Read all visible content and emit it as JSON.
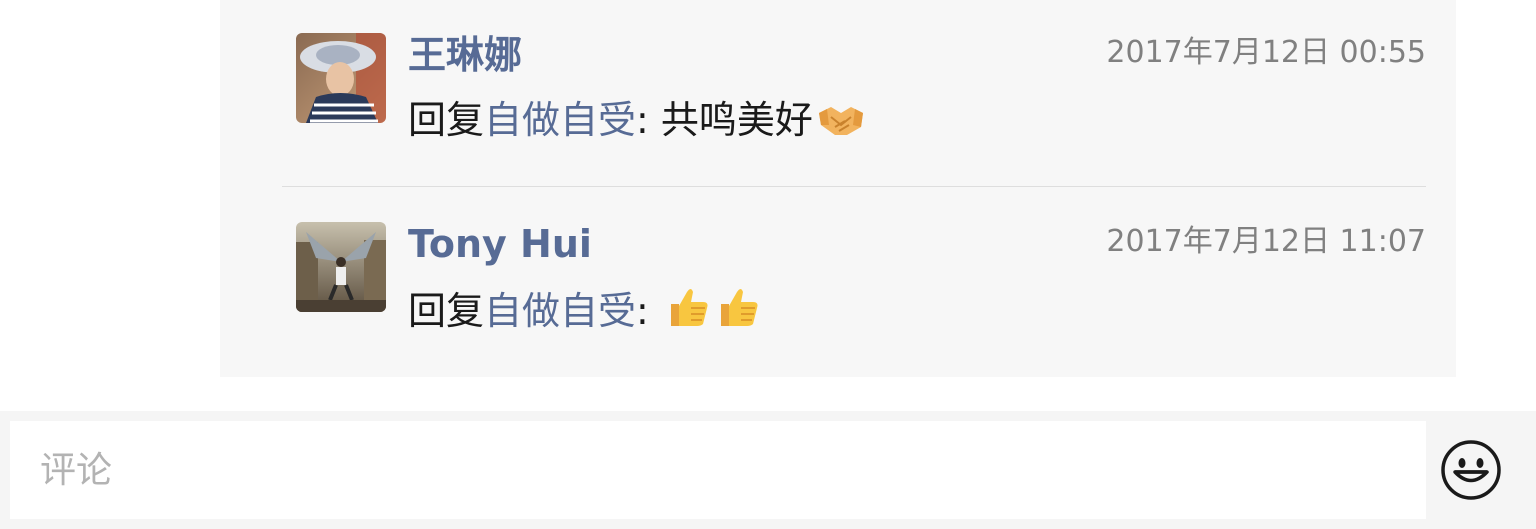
{
  "comments": [
    {
      "author": "王琳娜",
      "time": "2017年7月12日 00:55",
      "reply_prefix": "回复",
      "reply_target": "自做自受",
      "separator": ": ",
      "text": "共鸣美好",
      "emojis": [
        "handshake-emoji"
      ]
    },
    {
      "author": "Tony Hui",
      "time": "2017年7月12日 11:07",
      "reply_prefix": "回复",
      "reply_target": "自做自受",
      "separator": ": ",
      "text": "",
      "emojis": [
        "thumbs-up-emoji",
        "thumbs-up-emoji"
      ]
    }
  ],
  "input": {
    "placeholder": "评论"
  },
  "icons": {
    "emoji_button": "smiley-face-icon"
  },
  "colors": {
    "link": "#576b95",
    "panel_background": "#f7f7f7",
    "time_text": "#808080"
  }
}
